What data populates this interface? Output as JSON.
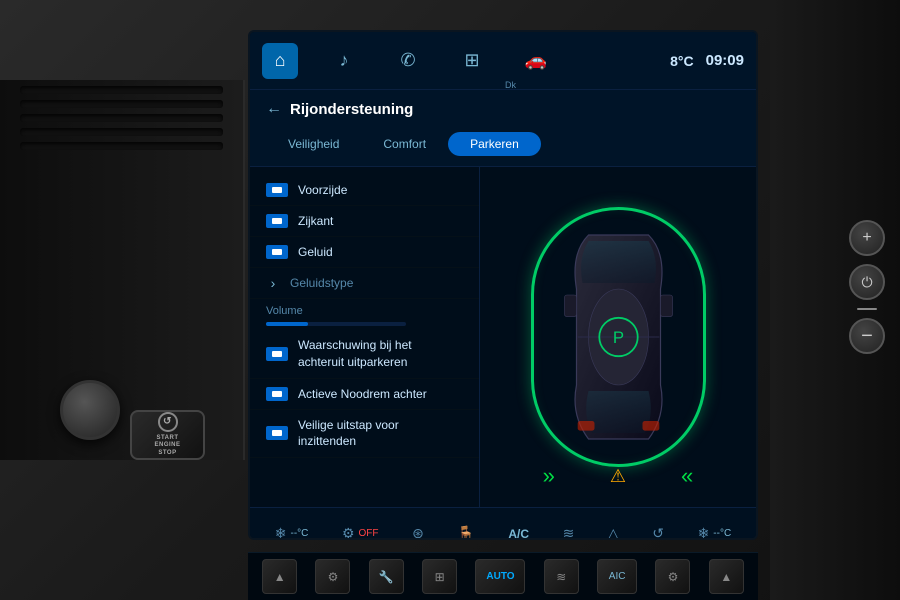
{
  "nav": {
    "temp": "8°C",
    "time": "09:09",
    "icons": [
      {
        "name": "home",
        "symbol": "⌂",
        "active": true
      },
      {
        "name": "music",
        "symbol": "♪",
        "active": false
      },
      {
        "name": "phone",
        "symbol": "✆",
        "active": false
      },
      {
        "name": "apps",
        "symbol": "⊞",
        "active": false
      },
      {
        "name": "car",
        "symbol": "🚗",
        "active": false
      }
    ]
  },
  "header": {
    "back_label": "←",
    "title": "Rijondersteuning"
  },
  "tabs": [
    {
      "label": "Veiligheid",
      "active": false
    },
    {
      "label": "Comfort",
      "active": false
    },
    {
      "label": "Parkeren",
      "active": true
    }
  ],
  "menu_items": [
    {
      "label": "Voorzijde",
      "has_icon": true,
      "dimmed": false
    },
    {
      "label": "Zijkant",
      "has_icon": true,
      "dimmed": false
    },
    {
      "label": "Geluid",
      "has_icon": true,
      "dimmed": false
    },
    {
      "label": "Geluidstype",
      "has_icon": false,
      "chevron": true,
      "dimmed": true
    }
  ],
  "volume": {
    "label": "Volume",
    "fill_percent": 30
  },
  "menu_items2": [
    {
      "label": "Waarschuwing bij het\nachteruit uitparkeren",
      "has_icon": true
    },
    {
      "label": "Actieve Noodrem achter",
      "has_icon": true
    },
    {
      "label": "Veilige uitstap voor\ninzittenden",
      "has_icon": true
    }
  ],
  "bottom_status": [
    {
      "icon": "❄",
      "label": "--°C"
    },
    {
      "icon": "⚙",
      "label": "OFF"
    },
    {
      "icon": "🔧",
      "label": ""
    },
    {
      "icon": "≡",
      "label": ""
    },
    {
      "icon": "A/C",
      "label": "A/C"
    },
    {
      "icon": "≡",
      "label": ""
    },
    {
      "icon": "△",
      "label": ""
    },
    {
      "icon": "~",
      "label": ""
    },
    {
      "icon": "❄",
      "label": "--°C"
    }
  ],
  "bottom_controls": [
    {
      "label": "▲",
      "type": "arrow"
    },
    {
      "label": "⚙",
      "type": "icon"
    },
    {
      "label": "🔧",
      "type": "icon"
    },
    {
      "label": "⊞",
      "type": "icon"
    },
    {
      "label": "AUTO",
      "type": "btn"
    },
    {
      "label": "⊞",
      "type": "icon"
    },
    {
      "label": "AIC",
      "type": "btn"
    },
    {
      "label": "⚙",
      "type": "icon"
    },
    {
      "label": "▲",
      "type": "arrow"
    }
  ],
  "dk_label": "Dk"
}
